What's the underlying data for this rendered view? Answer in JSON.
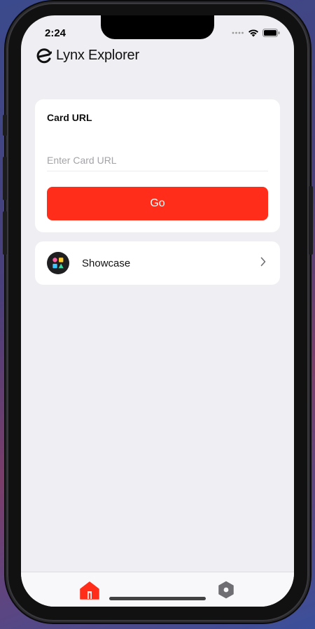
{
  "status_bar": {
    "time": "2:24",
    "icons": [
      "cellular-dots-icon",
      "wifi-icon",
      "battery-icon"
    ]
  },
  "header": {
    "title": "Lynx Explorer",
    "logo_icon": "lynx-logo-icon"
  },
  "card_url": {
    "label": "Card URL",
    "input_value": "",
    "input_placeholder": "Enter Card URL",
    "go_label": "Go"
  },
  "showcase": {
    "label": "Showcase",
    "icon": "shapes-icon"
  },
  "tab_bar": {
    "tabs": [
      {
        "name": "home",
        "icon": "home-icon",
        "active": true
      },
      {
        "name": "settings",
        "icon": "gear-icon",
        "active": false
      }
    ]
  },
  "colors": {
    "accent": "#ff2d19",
    "background": "#efeff3",
    "card": "#ffffff",
    "inactive_icon": "#6e6e73"
  }
}
